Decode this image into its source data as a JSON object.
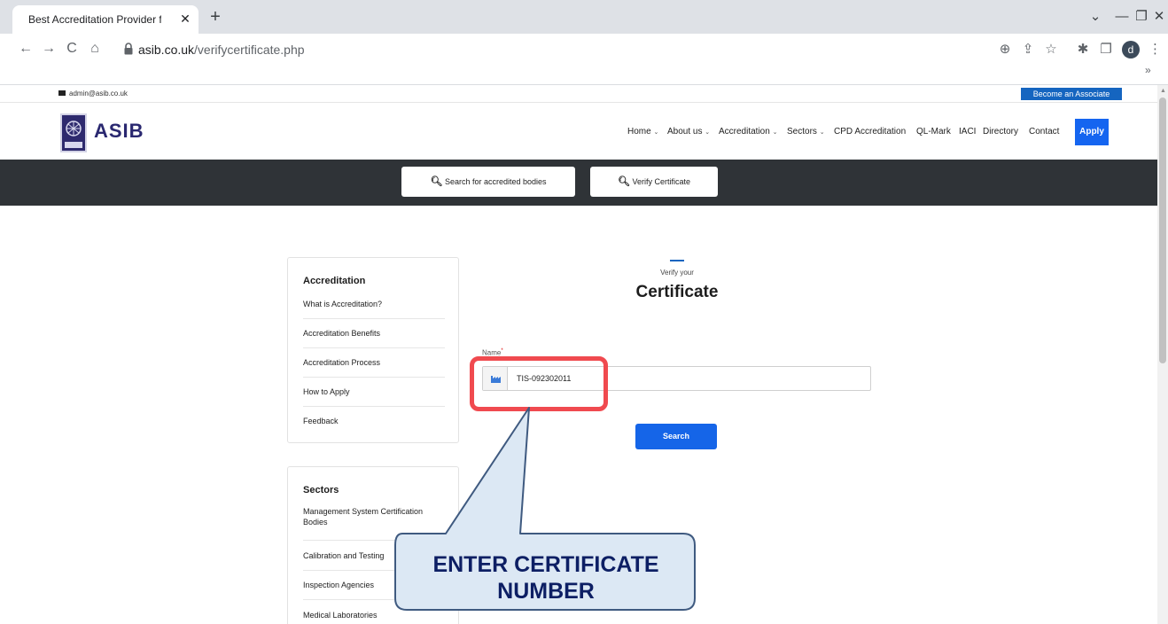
{
  "browser": {
    "tab_title": "Best Accreditation Provider for C",
    "tab_close": "✕",
    "new_tab": "+",
    "url_host": "asib.co.uk",
    "url_path": "/verifycertificate.php",
    "profile_initial": "d",
    "bookmark_overflow": "»",
    "controls": {
      "dropdown": "⌄",
      "minimize": "—",
      "maximize": "❐",
      "close": "✕"
    },
    "nav": {
      "back": "←",
      "forward": "→",
      "reload": "C",
      "home": "⌂"
    },
    "icons": {
      "zoom": "⊕",
      "share": "⇪",
      "star": "☆",
      "extensions": "✱",
      "sidepanel": "❐",
      "menu": "⋮"
    }
  },
  "site": {
    "email": "admin@asib.co.uk",
    "associate_label": "Become an Associate",
    "logo_text": "ASIB",
    "nav": {
      "items": [
        {
          "label": "Home",
          "chevron": "⌄"
        },
        {
          "label": "About us",
          "chevron": "⌄"
        },
        {
          "label": "Accreditation",
          "chevron": "⌄"
        },
        {
          "label": "Sectors",
          "chevron": "⌄"
        },
        {
          "label": "CPD Accreditation"
        },
        {
          "label": "QL-Mark"
        },
        {
          "label": "IACI"
        },
        {
          "label": "Directory"
        },
        {
          "label": "Contact"
        }
      ],
      "apply_label": "Apply"
    },
    "band": {
      "search_bodies_label": "Search for accredited bodies",
      "verify_label": "Verify Certificate"
    },
    "sidebar": {
      "accreditation": {
        "heading": "Accreditation",
        "links": [
          "What is Accreditation?",
          "Accreditation Benefits",
          "Accreditation Process",
          "How to Apply",
          "Feedback"
        ]
      },
      "sectors": {
        "heading": "Sectors",
        "links": [
          "Management System Certification Bodies",
          "Calibration and Testing",
          "Inspection Agencies",
          "Medical Laboratories"
        ]
      }
    },
    "form": {
      "subtitle": "Verify your",
      "title": "Certificate",
      "name_label": "Name",
      "required_mark": "*",
      "name_value": "TIS-092302011",
      "search_label": "Search"
    }
  },
  "annotation": {
    "callout_text": "ENTER CERTIFICATE NUMBER",
    "callout_fill": "#dce8f4",
    "callout_stroke": "#3f5a80",
    "highlight_color": "#f04a4f"
  }
}
